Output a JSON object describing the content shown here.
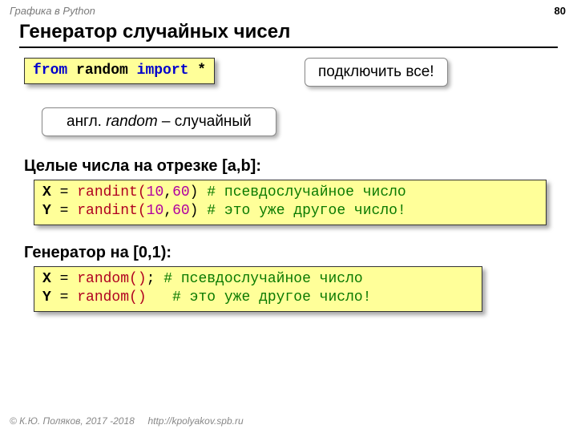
{
  "header": {
    "label": "Графика в Python",
    "page": "80"
  },
  "title": "Генератор случайных чисел",
  "code_import": {
    "from": "from",
    "mod": "random",
    "imp": "import",
    "star": "*"
  },
  "callout1": "подключить все!",
  "callout2": {
    "pre": "англ. ",
    "word": "random",
    "post": " – случайный"
  },
  "sub1": "Целые числа на отрезке [a,b]:",
  "code_int": {
    "l1": {
      "v": "X",
      "eq": " = ",
      "fn": "randint(",
      "a": "10",
      "c1": ",",
      "b": "60",
      "cp": ")",
      "sp": " ",
      "cm": "# псевдослучайное число"
    },
    "l2": {
      "v": "Y",
      "eq": " = ",
      "fn": "randint(",
      "a": "10",
      "c1": ",",
      "b": "60",
      "cp": ")",
      "sp": " ",
      "cm": "# это уже другое число!"
    }
  },
  "sub2": "Генератор на [0,1):",
  "code_rnd": {
    "l1": {
      "v": "X",
      "eq": " = ",
      "fn": "random()",
      "post": "; ",
      "cm": "# псевдослучайное число"
    },
    "l2": {
      "v": "Y",
      "eq": " = ",
      "fn": "random()",
      "post": "   ",
      "cm": "# это уже другое число!"
    }
  },
  "footer": {
    "c": "© К.Ю. Поляков, 2017 -2018",
    "url": "http://kpolyakov.spb.ru"
  }
}
